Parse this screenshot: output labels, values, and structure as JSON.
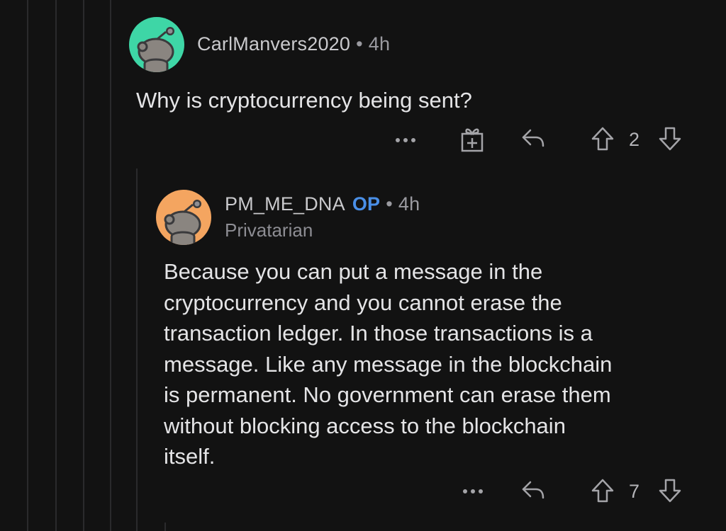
{
  "comments": [
    {
      "username": "CarlManvers2020",
      "separator": "•",
      "time": "4h",
      "body_lines": [
        "Why is cryptocurrency being sent?"
      ],
      "vote_count": "2",
      "avatar_color": "#3ed6a6"
    },
    {
      "username": "PM_ME_DNA",
      "op_badge": "OP",
      "separator": "•",
      "time": "4h",
      "flair": "Privatarian",
      "body_lines": [
        "Because you can put a message in the",
        "cryptocurrency and you cannot erase the",
        "transaction ledger. In those transactions is a",
        "message. Like any message in the blockchain",
        "is permanent. No government can erase them",
        "without blocking access to the blockchain",
        "itself."
      ],
      "vote_count": "7",
      "avatar_color": "#f4a560"
    }
  ],
  "icons": {
    "more": "more-options-icon",
    "award": "gift-award-icon",
    "reply": "reply-arrow-icon",
    "upvote": "upvote-arrow-icon",
    "downvote": "downvote-arrow-icon"
  },
  "colors": {
    "background": "#121212",
    "op_badge": "#4a8fe7",
    "text": "#e4e4e6",
    "muted": "#9a9aa0"
  }
}
